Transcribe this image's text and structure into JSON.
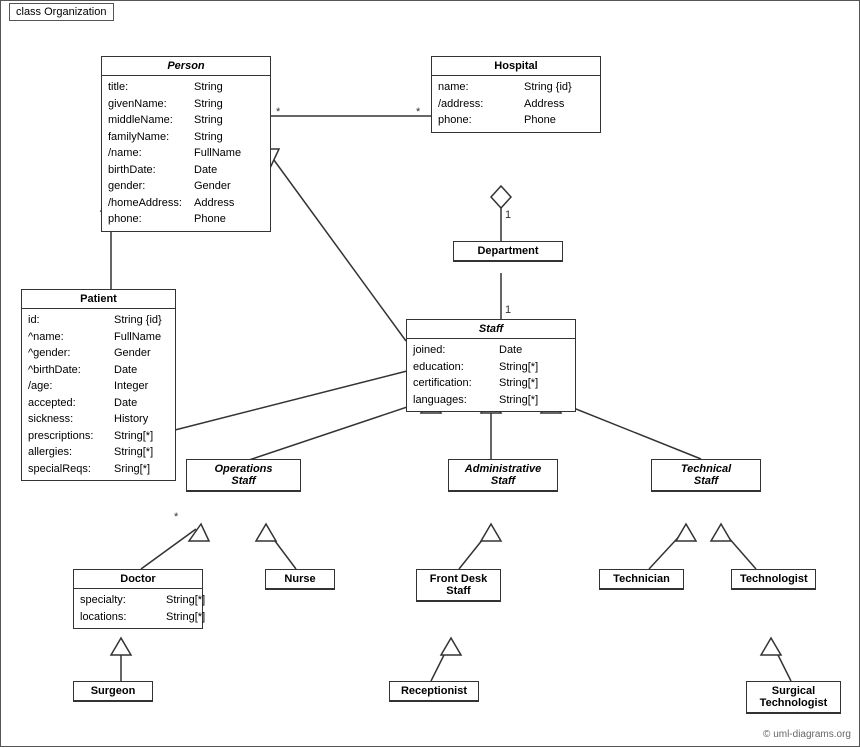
{
  "diagram": {
    "title": "class Organization",
    "classes": {
      "person": {
        "name": "Person",
        "italic": true,
        "attrs": [
          {
            "name": "title:",
            "type": "String"
          },
          {
            "name": "givenName:",
            "type": "String"
          },
          {
            "name": "middleName:",
            "type": "String"
          },
          {
            "name": "familyName:",
            "type": "String"
          },
          {
            "name": "/name:",
            "type": "FullName"
          },
          {
            "name": "birthDate:",
            "type": "Date"
          },
          {
            "name": "gender:",
            "type": "Gender"
          },
          {
            "name": "/homeAddress:",
            "type": "Address"
          },
          {
            "name": "phone:",
            "type": "Phone"
          }
        ]
      },
      "hospital": {
        "name": "Hospital",
        "italic": false,
        "attrs": [
          {
            "name": "name:",
            "type": "String {id}"
          },
          {
            "name": "/address:",
            "type": "Address"
          },
          {
            "name": "phone:",
            "type": "Phone"
          }
        ]
      },
      "department": {
        "name": "Department",
        "italic": false,
        "attrs": []
      },
      "staff": {
        "name": "Staff",
        "italic": true,
        "attrs": [
          {
            "name": "joined:",
            "type": "Date"
          },
          {
            "name": "education:",
            "type": "String[*]"
          },
          {
            "name": "certification:",
            "type": "String[*]"
          },
          {
            "name": "languages:",
            "type": "String[*]"
          }
        ]
      },
      "patient": {
        "name": "Patient",
        "italic": false,
        "attrs": [
          {
            "name": "id:",
            "type": "String {id}"
          },
          {
            "name": "^name:",
            "type": "FullName"
          },
          {
            "name": "^gender:",
            "type": "Gender"
          },
          {
            "name": "^birthDate:",
            "type": "Date"
          },
          {
            "name": "/age:",
            "type": "Integer"
          },
          {
            "name": "accepted:",
            "type": "Date"
          },
          {
            "name": "sickness:",
            "type": "History"
          },
          {
            "name": "prescriptions:",
            "type": "String[*]"
          },
          {
            "name": "allergies:",
            "type": "String[*]"
          },
          {
            "name": "specialReqs:",
            "type": "Sring[*]"
          }
        ]
      },
      "operations_staff": {
        "name": "Operations Staff",
        "italic": true,
        "attrs": []
      },
      "administrative_staff": {
        "name": "Administrative Staff",
        "italic": true,
        "attrs": []
      },
      "technical_staff": {
        "name": "Technical Staff",
        "italic": true,
        "attrs": []
      },
      "doctor": {
        "name": "Doctor",
        "italic": false,
        "attrs": [
          {
            "name": "specialty:",
            "type": "String[*]"
          },
          {
            "name": "locations:",
            "type": "String[*]"
          }
        ]
      },
      "nurse": {
        "name": "Nurse",
        "italic": false,
        "attrs": []
      },
      "front_desk_staff": {
        "name": "Front Desk Staff",
        "italic": false,
        "attrs": []
      },
      "technician": {
        "name": "Technician",
        "italic": false,
        "attrs": []
      },
      "technologist": {
        "name": "Technologist",
        "italic": false,
        "attrs": []
      },
      "surgeon": {
        "name": "Surgeon",
        "italic": false,
        "attrs": []
      },
      "receptionist": {
        "name": "Receptionist",
        "italic": false,
        "attrs": []
      },
      "surgical_technologist": {
        "name": "Surgical Technologist",
        "italic": false,
        "attrs": []
      }
    },
    "copyright": "© uml-diagrams.org"
  }
}
